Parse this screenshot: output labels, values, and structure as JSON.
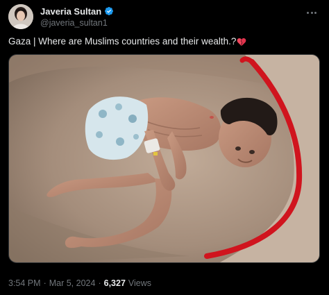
{
  "author": {
    "display_name": "Javeria Sultan",
    "handle": "@javeria_sultan1",
    "verified": true,
    "verified_color": "#1d9bf0"
  },
  "tweet": {
    "text": "Gaza | Where are Muslims countries and their wealth.?",
    "emoji_icon": "broken-heart-icon",
    "emoji_color": "#f0455c"
  },
  "meta": {
    "time": "3:54 PM",
    "separator": "·",
    "date": "Mar 5, 2024",
    "views_count": "6,327",
    "views_label": "Views"
  },
  "colors": {
    "background": "#000000",
    "text_primary": "#e7e9ea",
    "text_secondary": "#71767b",
    "border": "#2f3336",
    "blanket": "#b09a88",
    "blanket_trim": "#d0141e"
  }
}
